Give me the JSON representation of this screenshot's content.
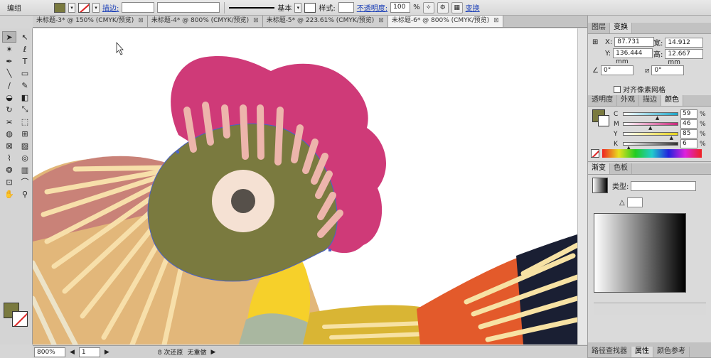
{
  "control_bar": {
    "mode_label": "编组",
    "fill_color": "#7a7a3f",
    "stroke_label": "描边:",
    "stroke_weight": "",
    "stroke_profile": "",
    "brush_label": "基本",
    "style_label": "样式:",
    "opacity_label": "不透明度:",
    "opacity_value": "100",
    "opacity_unit": "%",
    "transform_label": "变换"
  },
  "tabs": [
    {
      "label": "未标题-3* @ 150% (CMYK/预览)"
    },
    {
      "label": "未标题-4* @ 800% (CMYK/预览)"
    },
    {
      "label": "未标题-5* @ 223.61% (CMYK/预览)"
    },
    {
      "label": "未标题-6* @ 800% (CMYK/预览)"
    }
  ],
  "status_bar": {
    "zoom": "800%",
    "page": "1",
    "undo_text": "8 次还原",
    "redo_text": "无重做"
  },
  "transform_panel": {
    "tab_layers": "图层",
    "tab_transform": "变换",
    "x_label": "X:",
    "x_value": "87.731 mm",
    "y_label": "Y:",
    "y_value": "136.444 mm",
    "w_label": "宽:",
    "w_value": "14.912 mm",
    "h_label": "高:",
    "h_value": "12.667 mm",
    "angle_value": "0°",
    "shear_value": "0°",
    "align_pixel_label": "对齐像素网格"
  },
  "color_panel": {
    "tab_transparency": "透明度",
    "tab_appearance": "外观",
    "tab_stroke": "描边",
    "tab_color": "颜色",
    "channels": [
      {
        "label": "C",
        "value": "59",
        "unit": "%",
        "level": 0.59
      },
      {
        "label": "M",
        "value": "46",
        "unit": "%",
        "level": 0.46
      },
      {
        "label": "Y",
        "value": "85",
        "unit": "%",
        "level": 0.85
      },
      {
        "label": "K",
        "value": "6",
        "unit": "%",
        "level": 0.06
      }
    ],
    "current_color": "#7a7a3f"
  },
  "gradient_panel": {
    "tab_gradient": "渐变",
    "tab_swatches": "色板",
    "type_label": "类型:",
    "type_value": ""
  },
  "bottom_panel": {
    "tab_pathfinder": "路径查找器",
    "tab_attributes": "属性",
    "tab_color_ref": "颜色参考"
  }
}
